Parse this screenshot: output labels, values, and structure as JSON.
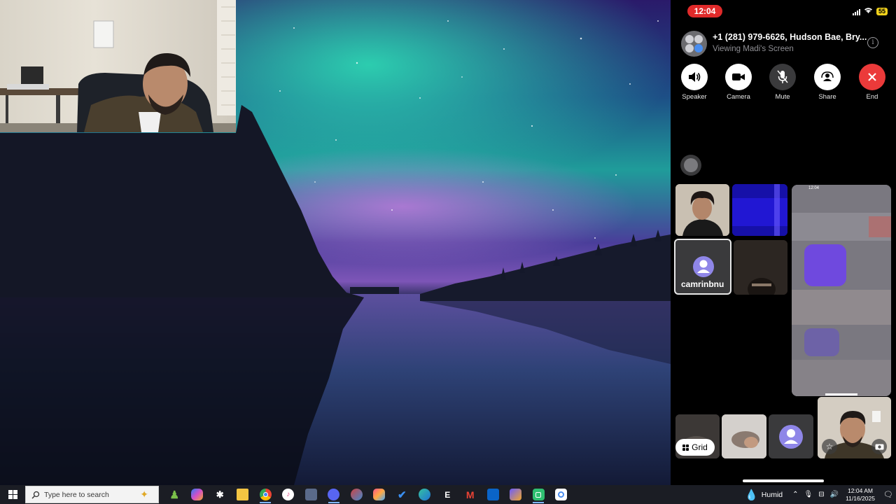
{
  "phone": {
    "status_time": "12:04",
    "battery": "55",
    "call_title": "+1 (281) 979-6626, Hudson Bae, Bry...",
    "call_subtitle": "Viewing Madi's Screen",
    "controls": [
      {
        "label": "Speaker",
        "icon": "speaker-icon"
      },
      {
        "label": "Camera",
        "icon": "camera-icon"
      },
      {
        "label": "Mute",
        "icon": "mute-icon"
      },
      {
        "label": "Share",
        "icon": "share-icon"
      },
      {
        "label": "End",
        "icon": "end-call-icon"
      }
    ],
    "participant_name": "camrinbnu",
    "shared_screen_time": "12:04",
    "grid_label": "Grid"
  },
  "taskbar": {
    "search_placeholder": "Type here to search",
    "weather": "Humid",
    "time": "12:04 AM",
    "date": "11/16/2025",
    "apps": [
      "chess-icon",
      "copilot-icon",
      "app-icon",
      "file-explorer-icon",
      "chrome-icon",
      "itunes-icon",
      "app-icon",
      "discord-icon",
      "app-icon",
      "app-icon",
      "todo-icon",
      "edge-icon",
      "epic-games-icon",
      "gmail-icon",
      "outlook-icon",
      "app-icon",
      "phone-link-icon",
      "app-icon"
    ]
  },
  "colors": {
    "end_red": "#eb3a3a",
    "status_red": "#e02a2a",
    "battery_yellow": "#f2d21c",
    "taskbar": "#1b1d24"
  }
}
